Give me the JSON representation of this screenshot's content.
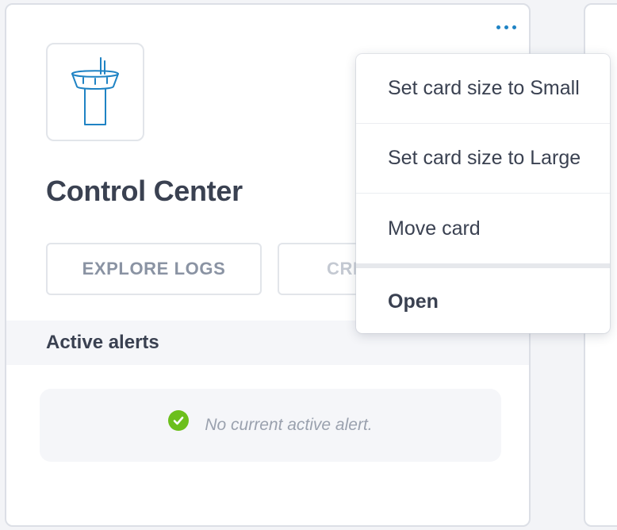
{
  "card": {
    "title": "Control Center",
    "icon": "control-tower-icon",
    "buttons": {
      "explore_logs": "EXPLORE LOGS",
      "create": "CRE"
    },
    "alerts": {
      "header": "Active alerts",
      "empty_message": "No current active alert.",
      "status_icon": "check-circle-icon",
      "status_color": "#6cbf1c"
    },
    "more_menu_icon": "more-horizontal-icon"
  },
  "menu": {
    "items": [
      {
        "label": "Set card size to Small"
      },
      {
        "label": "Set card size to Large"
      },
      {
        "label": "Move card"
      },
      {
        "label": "Open"
      }
    ]
  },
  "colors": {
    "accent": "#1f83c4",
    "text": "#3a4151",
    "muted": "#8a93a3"
  }
}
